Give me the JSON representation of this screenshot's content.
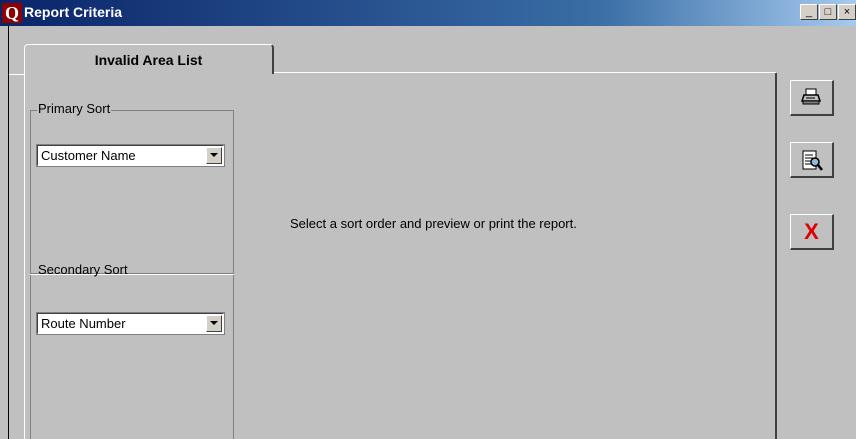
{
  "window": {
    "title": "Report Criteria",
    "app_icon_letter": "Q",
    "minimize_glyph": "_",
    "maximize_glyph": "□",
    "close_glyph": "×"
  },
  "tabs": [
    {
      "label": "Invalid Area List",
      "selected": true
    }
  ],
  "primary_sort": {
    "group_label": "Primary Sort",
    "selected_value": "Customer Name"
  },
  "secondary_sort": {
    "group_label": "Secondary Sort",
    "selected_value": "Route Number"
  },
  "message": "Select a sort order and preview or print the report.",
  "buttons": {
    "print_icon": "printer-icon",
    "preview_icon": "preview-icon",
    "cancel_icon": "close-icon",
    "cancel_glyph": "X",
    "cancel_color": "#e00000"
  }
}
